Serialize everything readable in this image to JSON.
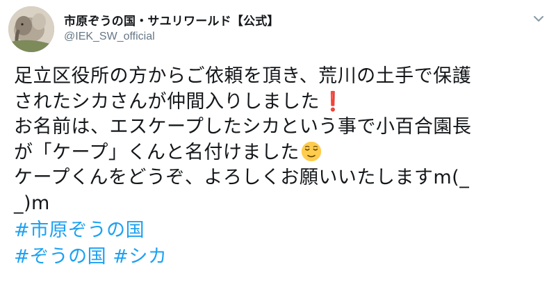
{
  "account": {
    "display_name": "市原ぞうの国・サユリワールド【公式】",
    "handle": "@IEK_SW_official",
    "avatar_icon": "elephant-photo-icon",
    "menu_icon": "chevron-down-icon"
  },
  "tweet": {
    "lines": [
      "足立区役所の方からご依頼を頂き、荒川の土手で保護",
      "されたシカさんが仲間入りしました",
      "お名前は、エスケープしたシカという事で小百合園長",
      "が「ケープ」くんと名付けました",
      "ケープくんをどうぞ、よろしくお願いいたしますm(_",
      "_)m"
    ],
    "exclamation_emoji": "❗",
    "hashtags_line1": [
      "#市原ぞうの国"
    ],
    "hashtags_line2": [
      "#ぞうの国",
      "#シカ"
    ]
  },
  "colors": {
    "text": "#14171a",
    "secondary": "#657786",
    "link": "#1da1f2",
    "exclamation": "#e0245e"
  }
}
